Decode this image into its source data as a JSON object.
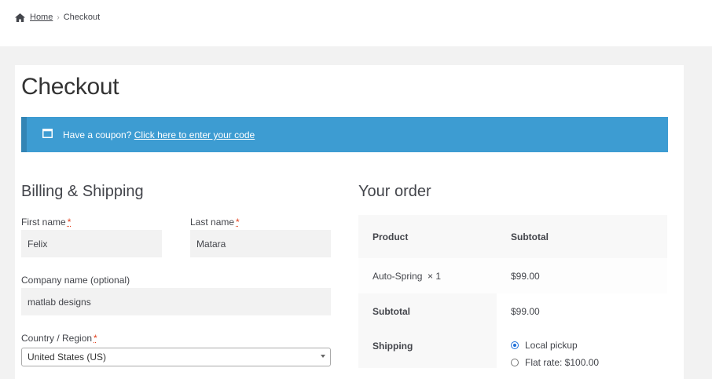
{
  "breadcrumb": {
    "home": "Home",
    "separator": "›",
    "current": "Checkout"
  },
  "page": {
    "title": "Checkout"
  },
  "notice": {
    "text": "Have a coupon?",
    "link": "Click here to enter your code"
  },
  "billing": {
    "title": "Billing & Shipping",
    "first_name": {
      "label": "First name",
      "required": "*",
      "value": "Felix"
    },
    "last_name": {
      "label": "Last name",
      "required": "*",
      "value": "Matara"
    },
    "company": {
      "label": "Company name (optional)",
      "value": "matlab designs"
    },
    "country": {
      "label": "Country / Region",
      "required": "*",
      "value": "United States (US)"
    }
  },
  "order": {
    "title": "Your order",
    "header": {
      "product": "Product",
      "subtotal": "Subtotal"
    },
    "item": {
      "name": "Auto-Spring",
      "qty": "× 1",
      "price": "$99.00"
    },
    "subtotal": {
      "label": "Subtotal",
      "value": "$99.00"
    },
    "shipping": {
      "label": "Shipping",
      "options": [
        {
          "label": "Local pickup",
          "checked": true
        },
        {
          "label": "Flat rate: $100.00",
          "checked": false
        }
      ]
    }
  },
  "colors": {
    "notice_bg": "#3d9cd2",
    "notice_border": "#3385b5",
    "required": "#e2401c"
  }
}
